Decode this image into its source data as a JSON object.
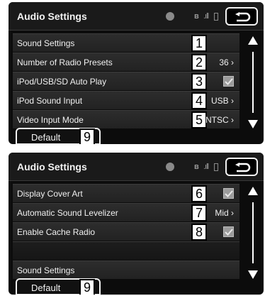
{
  "screens": [
    {
      "title": "Audio Settings",
      "rows": [
        {
          "label": "Sound Settings",
          "value": "",
          "check": false,
          "callout": "1"
        },
        {
          "label": "Number of Radio Presets",
          "value": "36 ›",
          "check": false,
          "callout": "2"
        },
        {
          "label": "iPod/USB/SD Auto Play",
          "value": "",
          "check": true,
          "callout": "3"
        },
        {
          "label": "iPod Sound Input",
          "value": "USB ›",
          "check": false,
          "callout": "4"
        },
        {
          "label": "Video Input Mode",
          "value": "NTSC ›",
          "check": false,
          "callout": "5"
        }
      ],
      "default_label": "Default",
      "default_callout": "9"
    },
    {
      "title": "Audio Settings",
      "rows": [
        {
          "label": "Display Cover Art",
          "value": "",
          "check": true,
          "callout": "6"
        },
        {
          "label": "Automatic Sound Levelizer",
          "value": "Mid ›",
          "check": false,
          "callout": "7"
        },
        {
          "label": "Enable Cache Radio",
          "value": "",
          "check": true,
          "callout": "8"
        },
        {
          "label": "",
          "value": "",
          "check": false,
          "callout": ""
        },
        {
          "label": "Sound Settings",
          "value": "",
          "check": false,
          "callout": ""
        }
      ],
      "default_label": "Default",
      "default_callout": "9"
    }
  ],
  "icons": {
    "bluetooth": "bluetooth-icon",
    "signal": "signal-bars-icon",
    "battery": "battery-icon",
    "back": "back-arrow-icon",
    "phone": "phone-status-icon"
  }
}
